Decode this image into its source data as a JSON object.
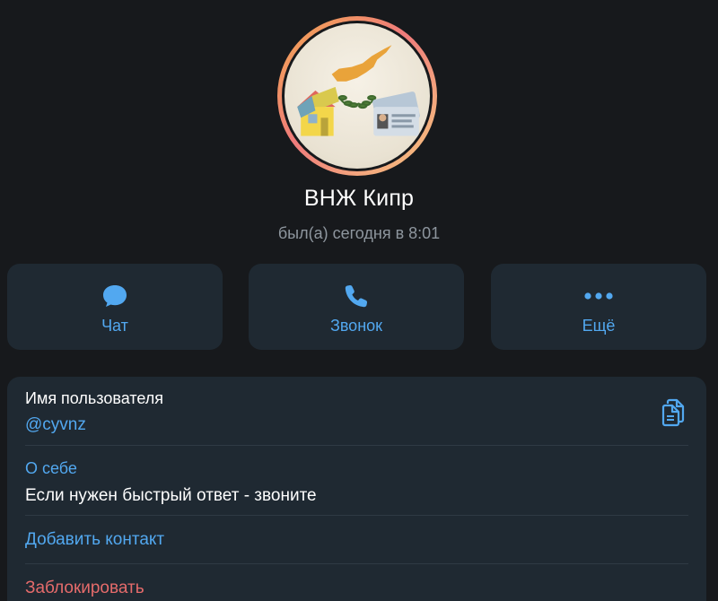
{
  "profile": {
    "name": "ВНЖ Кипр",
    "status": "был(а) сегодня в 8:01",
    "avatar_icon": "cyprus-flag-house-idcards-avatar"
  },
  "actions": {
    "chat": {
      "label": "Чат",
      "icon": "chat-bubble-icon"
    },
    "call": {
      "label": "Звонок",
      "icon": "phone-icon"
    },
    "more": {
      "label": "Ещё",
      "icon": "more-dots-icon"
    }
  },
  "info": {
    "username_label": "Имя пользователя",
    "username_value": "@cyvnz",
    "copy_icon": "copy-icon",
    "about_label": "О себе",
    "about_value": "Если нужен быстрый ответ - звоните",
    "add_contact": "Добавить контакт",
    "block": "Заблокировать"
  },
  "colors": {
    "background": "#17191c",
    "card": "#1f2932",
    "accent": "#52a8f0",
    "danger": "#e56b6b",
    "secondary_text": "#8e969e"
  }
}
